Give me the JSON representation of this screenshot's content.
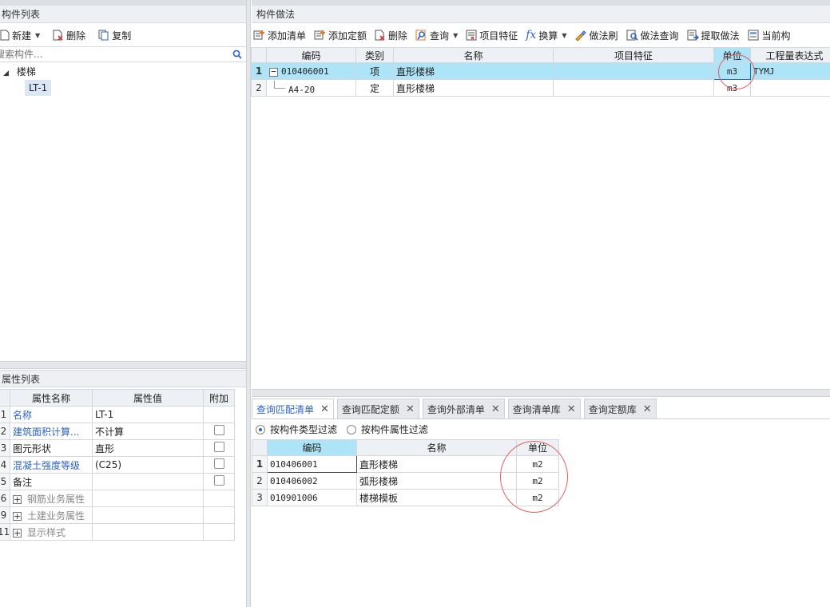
{
  "left_panel": {
    "title": "构件列表",
    "toolbar": [
      {
        "label": "新建",
        "icon": "new-icon",
        "dropdown": true
      },
      {
        "label": "删除",
        "icon": "delete-icon",
        "dropdown": false
      },
      {
        "label": "复制",
        "icon": "copy-icon",
        "dropdown": false
      }
    ],
    "search_placeholder": "搜索构件...",
    "tree": {
      "root": "楼梯",
      "child": "LT-1"
    }
  },
  "props_panel": {
    "title": "属性列表",
    "columns": [
      "属性名称",
      "属性值",
      "附加"
    ],
    "rows": [
      {
        "num": "1",
        "name": "名称",
        "value": "LT-1",
        "blue": true,
        "checkbox": false,
        "expand": false
      },
      {
        "num": "2",
        "name": "建筑面积计算...",
        "value": "不计算",
        "blue": true,
        "checkbox": true,
        "expand": false
      },
      {
        "num": "3",
        "name": "图元形状",
        "value": "直形",
        "blue": false,
        "checkbox": true,
        "expand": false
      },
      {
        "num": "4",
        "name": "混凝土强度等级",
        "value": "(C25)",
        "blue": true,
        "checkbox": true,
        "expand": false
      },
      {
        "num": "5",
        "name": "备注",
        "value": "",
        "blue": false,
        "checkbox": true,
        "expand": false
      },
      {
        "num": "6",
        "name": "钢筋业务属性",
        "value": "",
        "blue": false,
        "checkbox": false,
        "expand": true
      },
      {
        "num": "9",
        "name": "土建业务属性",
        "value": "",
        "blue": false,
        "checkbox": false,
        "expand": true
      },
      {
        "num": "11",
        "name": "显示样式",
        "value": "",
        "blue": false,
        "checkbox": false,
        "expand": true
      }
    ]
  },
  "method_panel": {
    "title": "构件做法",
    "toolbar": [
      {
        "label": "添加清单",
        "icon": "add-list-icon",
        "dropdown": false
      },
      {
        "label": "添加定额",
        "icon": "add-quota-icon",
        "dropdown": false
      },
      {
        "label": "删除",
        "icon": "delete-icon",
        "dropdown": false
      },
      {
        "label": "查询",
        "icon": "query-icon",
        "dropdown": true
      },
      {
        "label": "项目特征",
        "icon": "feature-icon",
        "dropdown": false
      },
      {
        "label": "换算",
        "icon": "fx-icon",
        "dropdown": true
      },
      {
        "label": "做法刷",
        "icon": "brush-icon",
        "dropdown": false
      },
      {
        "label": "做法查询",
        "icon": "method-query-icon",
        "dropdown": false
      },
      {
        "label": "提取做法",
        "icon": "extract-icon",
        "dropdown": false
      },
      {
        "label": "当前构",
        "icon": "current-icon",
        "dropdown": false
      }
    ],
    "columns": [
      "编码",
      "类别",
      "名称",
      "项目特征",
      "单位",
      "工程量表达式"
    ],
    "rows": [
      {
        "num": "1",
        "code": "010406001",
        "type": "项",
        "name": "直形楼梯",
        "feature": "",
        "unit": "m3",
        "expr": "TYMJ"
      },
      {
        "num": "2",
        "code": "A4-20",
        "type": "定",
        "name": "直形楼梯",
        "feature": "",
        "unit": "m3",
        "expr": ""
      }
    ]
  },
  "query_panel": {
    "tabs": [
      "查询匹配清单",
      "查询匹配定额",
      "查询外部清单",
      "查询清单库",
      "查询定额库"
    ],
    "filters": [
      "按构件类型过滤",
      "按构件属性过滤"
    ],
    "columns": [
      "编码",
      "名称",
      "单位"
    ],
    "rows": [
      {
        "num": "1",
        "code": "010406001",
        "name": "直形楼梯",
        "unit": "m2"
      },
      {
        "num": "2",
        "code": "010406002",
        "name": "弧形楼梯",
        "unit": "m2"
      },
      {
        "num": "3",
        "code": "010901006",
        "name": "楼梯模板",
        "unit": "m2"
      }
    ]
  },
  "colors": {
    "accent": "#2e63c6",
    "selected_row": "#aee4f7",
    "annotation": "#e06060"
  }
}
